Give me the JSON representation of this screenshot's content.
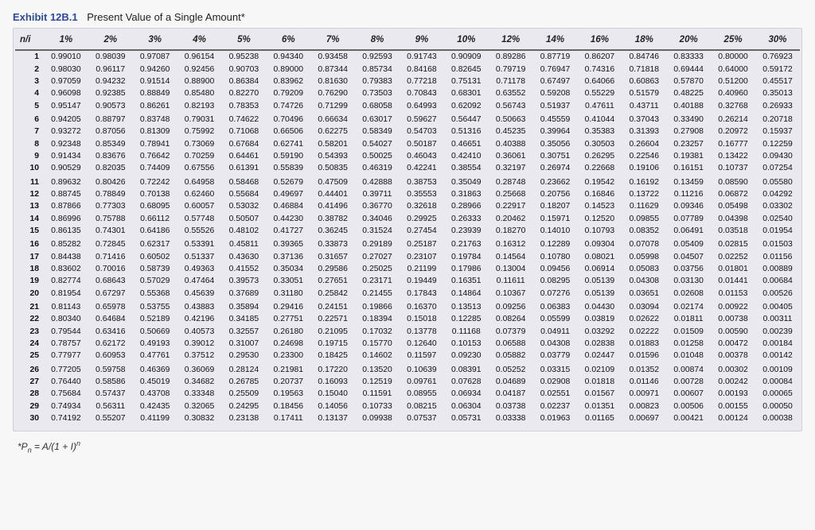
{
  "exhibit": {
    "label": "Exhibit 12B.1",
    "title": "Present Value of a Single Amount*"
  },
  "corner_label": "n/i",
  "formula_html": "*P<sub>n</sub> = A/(1 + I)<sup>n</sup>",
  "chart_data": {
    "type": "table",
    "title": "Present Value of a Single Amount",
    "columns": [
      "1%",
      "2%",
      "3%",
      "4%",
      "5%",
      "6%",
      "7%",
      "8%",
      "9%",
      "10%",
      "12%",
      "14%",
      "16%",
      "18%",
      "20%",
      "25%",
      "30%"
    ],
    "rows": [
      {
        "n": 1,
        "values": [
          "0.99010",
          "0.98039",
          "0.97087",
          "0.96154",
          "0.95238",
          "0.94340",
          "0.93458",
          "0.92593",
          "0.91743",
          "0.90909",
          "0.89286",
          "0.87719",
          "0.86207",
          "0.84746",
          "0.83333",
          "0.80000",
          "0.76923"
        ]
      },
      {
        "n": 2,
        "values": [
          "0.98030",
          "0.96117",
          "0.94260",
          "0.92456",
          "0.90703",
          "0.89000",
          "0.87344",
          "0.85734",
          "0.84168",
          "0.82645",
          "0.79719",
          "0.76947",
          "0.74316",
          "0.71818",
          "0.69444",
          "0.64000",
          "0.59172"
        ]
      },
      {
        "n": 3,
        "values": [
          "0.97059",
          "0.94232",
          "0.91514",
          "0.88900",
          "0.86384",
          "0.83962",
          "0.81630",
          "0.79383",
          "0.77218",
          "0.75131",
          "0.71178",
          "0.67497",
          "0.64066",
          "0.60863",
          "0.57870",
          "0.51200",
          "0.45517"
        ]
      },
      {
        "n": 4,
        "values": [
          "0.96098",
          "0.92385",
          "0.88849",
          "0.85480",
          "0.82270",
          "0.79209",
          "0.76290",
          "0.73503",
          "0.70843",
          "0.68301",
          "0.63552",
          "0.59208",
          "0.55229",
          "0.51579",
          "0.48225",
          "0.40960",
          "0.35013"
        ]
      },
      {
        "n": 5,
        "values": [
          "0.95147",
          "0.90573",
          "0.86261",
          "0.82193",
          "0.78353",
          "0.74726",
          "0.71299",
          "0.68058",
          "0.64993",
          "0.62092",
          "0.56743",
          "0.51937",
          "0.47611",
          "0.43711",
          "0.40188",
          "0.32768",
          "0.26933"
        ]
      },
      {
        "n": 6,
        "values": [
          "0.94205",
          "0.88797",
          "0.83748",
          "0.79031",
          "0.74622",
          "0.70496",
          "0.66634",
          "0.63017",
          "0.59627",
          "0.56447",
          "0.50663",
          "0.45559",
          "0.41044",
          "0.37043",
          "0.33490",
          "0.26214",
          "0.20718"
        ]
      },
      {
        "n": 7,
        "values": [
          "0.93272",
          "0.87056",
          "0.81309",
          "0.75992",
          "0.71068",
          "0.66506",
          "0.62275",
          "0.58349",
          "0.54703",
          "0.51316",
          "0.45235",
          "0.39964",
          "0.35383",
          "0.31393",
          "0.27908",
          "0.20972",
          "0.15937"
        ]
      },
      {
        "n": 8,
        "values": [
          "0.92348",
          "0.85349",
          "0.78941",
          "0.73069",
          "0.67684",
          "0.62741",
          "0.58201",
          "0.54027",
          "0.50187",
          "0.46651",
          "0.40388",
          "0.35056",
          "0.30503",
          "0.26604",
          "0.23257",
          "0.16777",
          "0.12259"
        ]
      },
      {
        "n": 9,
        "values": [
          "0.91434",
          "0.83676",
          "0.76642",
          "0.70259",
          "0.64461",
          "0.59190",
          "0.54393",
          "0.50025",
          "0.46043",
          "0.42410",
          "0.36061",
          "0.30751",
          "0.26295",
          "0.22546",
          "0.19381",
          "0.13422",
          "0.09430"
        ]
      },
      {
        "n": 10,
        "values": [
          "0.90529",
          "0.82035",
          "0.74409",
          "0.67556",
          "0.61391",
          "0.55839",
          "0.50835",
          "0.46319",
          "0.42241",
          "0.38554",
          "0.32197",
          "0.26974",
          "0.22668",
          "0.19106",
          "0.16151",
          "0.10737",
          "0.07254"
        ]
      },
      {
        "n": 11,
        "values": [
          "0.89632",
          "0.80426",
          "0.72242",
          "0.64958",
          "0.58468",
          "0.52679",
          "0.47509",
          "0.42888",
          "0.38753",
          "0.35049",
          "0.28748",
          "0.23662",
          "0.19542",
          "0.16192",
          "0.13459",
          "0.08590",
          "0.05580"
        ]
      },
      {
        "n": 12,
        "values": [
          "0.88745",
          "0.78849",
          "0.70138",
          "0.62460",
          "0.55684",
          "0.49697",
          "0.44401",
          "0.39711",
          "0.35553",
          "0.31863",
          "0.25668",
          "0.20756",
          "0.16846",
          "0.13722",
          "0.11216",
          "0.06872",
          "0.04292"
        ]
      },
      {
        "n": 13,
        "values": [
          "0.87866",
          "0.77303",
          "0.68095",
          "0.60057",
          "0.53032",
          "0.46884",
          "0.41496",
          "0.36770",
          "0.32618",
          "0.28966",
          "0.22917",
          "0.18207",
          "0.14523",
          "0.11629",
          "0.09346",
          "0.05498",
          "0.03302"
        ]
      },
      {
        "n": 14,
        "values": [
          "0.86996",
          "0.75788",
          "0.66112",
          "0.57748",
          "0.50507",
          "0.44230",
          "0.38782",
          "0.34046",
          "0.29925",
          "0.26333",
          "0.20462",
          "0.15971",
          "0.12520",
          "0.09855",
          "0.07789",
          "0.04398",
          "0.02540"
        ]
      },
      {
        "n": 15,
        "values": [
          "0.86135",
          "0.74301",
          "0.64186",
          "0.55526",
          "0.48102",
          "0.41727",
          "0.36245",
          "0.31524",
          "0.27454",
          "0.23939",
          "0.18270",
          "0.14010",
          "0.10793",
          "0.08352",
          "0.06491",
          "0.03518",
          "0.01954"
        ]
      },
      {
        "n": 16,
        "values": [
          "0.85282",
          "0.72845",
          "0.62317",
          "0.53391",
          "0.45811",
          "0.39365",
          "0.33873",
          "0.29189",
          "0.25187",
          "0.21763",
          "0.16312",
          "0.12289",
          "0.09304",
          "0.07078",
          "0.05409",
          "0.02815",
          "0.01503"
        ]
      },
      {
        "n": 17,
        "values": [
          "0.84438",
          "0.71416",
          "0.60502",
          "0.51337",
          "0.43630",
          "0.37136",
          "0.31657",
          "0.27027",
          "0.23107",
          "0.19784",
          "0.14564",
          "0.10780",
          "0.08021",
          "0.05998",
          "0.04507",
          "0.02252",
          "0.01156"
        ]
      },
      {
        "n": 18,
        "values": [
          "0.83602",
          "0.70016",
          "0.58739",
          "0.49363",
          "0.41552",
          "0.35034",
          "0.29586",
          "0.25025",
          "0.21199",
          "0.17986",
          "0.13004",
          "0.09456",
          "0.06914",
          "0.05083",
          "0.03756",
          "0.01801",
          "0.00889"
        ]
      },
      {
        "n": 19,
        "values": [
          "0.82774",
          "0.68643",
          "0.57029",
          "0.47464",
          "0.39573",
          "0.33051",
          "0.27651",
          "0.23171",
          "0.19449",
          "0.16351",
          "0.11611",
          "0.08295",
          "0.05139",
          "0.04308",
          "0.03130",
          "0.01441",
          "0.00684"
        ]
      },
      {
        "n": 20,
        "values": [
          "0.81954",
          "0.67297",
          "0.55368",
          "0.45639",
          "0.37689",
          "0.31180",
          "0.25842",
          "0.21455",
          "0.17843",
          "0.14864",
          "0.10367",
          "0.07276",
          "0.05139",
          "0.03651",
          "0.02608",
          "0.01153",
          "0.00526"
        ]
      },
      {
        "n": 21,
        "values": [
          "0.81143",
          "0.65978",
          "0.53755",
          "0.43883",
          "0.35894",
          "0.29416",
          "0.24151",
          "0.19866",
          "0.16370",
          "0.13513",
          "0.09256",
          "0.06383",
          "0.04430",
          "0.03094",
          "0.02174",
          "0.00922",
          "0.00405"
        ]
      },
      {
        "n": 22,
        "values": [
          "0.80340",
          "0.64684",
          "0.52189",
          "0.42196",
          "0.34185",
          "0.27751",
          "0.22571",
          "0.18394",
          "0.15018",
          "0.12285",
          "0.08264",
          "0.05599",
          "0.03819",
          "0.02622",
          "0.01811",
          "0.00738",
          "0.00311"
        ]
      },
      {
        "n": 23,
        "values": [
          "0.79544",
          "0.63416",
          "0.50669",
          "0.40573",
          "0.32557",
          "0.26180",
          "0.21095",
          "0.17032",
          "0.13778",
          "0.11168",
          "0.07379",
          "0.04911",
          "0.03292",
          "0.02222",
          "0.01509",
          "0.00590",
          "0.00239"
        ]
      },
      {
        "n": 24,
        "values": [
          "0.78757",
          "0.62172",
          "0.49193",
          "0.39012",
          "0.31007",
          "0.24698",
          "0.19715",
          "0.15770",
          "0.12640",
          "0.10153",
          "0.06588",
          "0.04308",
          "0.02838",
          "0.01883",
          "0.01258",
          "0.00472",
          "0.00184"
        ]
      },
      {
        "n": 25,
        "values": [
          "0.77977",
          "0.60953",
          "0.47761",
          "0.37512",
          "0.29530",
          "0.23300",
          "0.18425",
          "0.14602",
          "0.11597",
          "0.09230",
          "0.05882",
          "0.03779",
          "0.02447",
          "0.01596",
          "0.01048",
          "0.00378",
          "0.00142"
        ]
      },
      {
        "n": 26,
        "values": [
          "0.77205",
          "0.59758",
          "0.46369",
          "0.36069",
          "0.28124",
          "0.21981",
          "0.17220",
          "0.13520",
          "0.10639",
          "0.08391",
          "0.05252",
          "0.03315",
          "0.02109",
          "0.01352",
          "0.00874",
          "0.00302",
          "0.00109"
        ]
      },
      {
        "n": 27,
        "values": [
          "0.76440",
          "0.58586",
          "0.45019",
          "0.34682",
          "0.26785",
          "0.20737",
          "0.16093",
          "0.12519",
          "0.09761",
          "0.07628",
          "0.04689",
          "0.02908",
          "0.01818",
          "0.01146",
          "0.00728",
          "0.00242",
          "0.00084"
        ]
      },
      {
        "n": 28,
        "values": [
          "0.75684",
          "0.57437",
          "0.43708",
          "0.33348",
          "0.25509",
          "0.19563",
          "0.15040",
          "0.11591",
          "0.08955",
          "0.06934",
          "0.04187",
          "0.02551",
          "0.01567",
          "0.00971",
          "0.00607",
          "0.00193",
          "0.00065"
        ]
      },
      {
        "n": 29,
        "values": [
          "0.74934",
          "0.56311",
          "0.42435",
          "0.32065",
          "0.24295",
          "0.18456",
          "0.14056",
          "0.10733",
          "0.08215",
          "0.06304",
          "0.03738",
          "0.02237",
          "0.01351",
          "0.00823",
          "0.00506",
          "0.00155",
          "0.00050"
        ]
      },
      {
        "n": 30,
        "values": [
          "0.74192",
          "0.55207",
          "0.41199",
          "0.30832",
          "0.23138",
          "0.17411",
          "0.13137",
          "0.09938",
          "0.07537",
          "0.05731",
          "0.03338",
          "0.01963",
          "0.01165",
          "0.00697",
          "0.00421",
          "0.00124",
          "0.00038"
        ]
      }
    ]
  }
}
